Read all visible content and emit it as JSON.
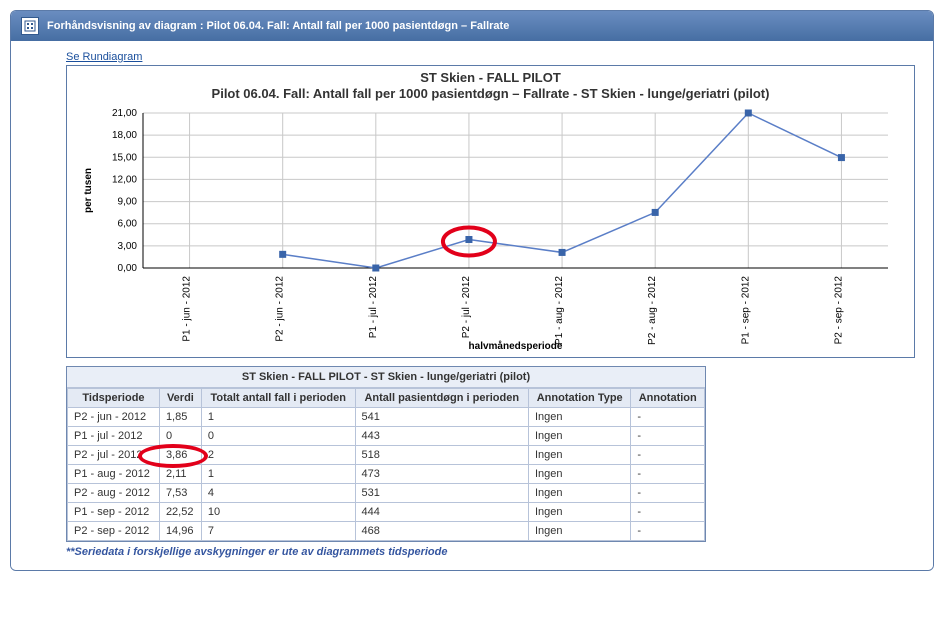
{
  "header": {
    "title": "Forhåndsvisning av diagram : Pilot 06.04. Fall: Antall fall per 1000 pasientdøgn – Fallrate"
  },
  "links": {
    "rundiagram": "Se Rundiagram"
  },
  "chart_data": {
    "type": "line",
    "title": "ST Skien - FALL PILOT",
    "subtitle": "Pilot 06.04. Fall: Antall fall per 1000 pasientdøgn – Fallrate - ST Skien - lunge/geriatri (pilot)",
    "ylabel": "per tusen",
    "xlabel": "halvmånedsperiode",
    "ylim": [
      0,
      21
    ],
    "yticks": [
      0,
      3,
      6,
      9,
      12,
      15,
      18,
      21
    ],
    "ytick_labels": [
      "0,00",
      "3,00",
      "6,00",
      "9,00",
      "12,00",
      "15,00",
      "18,00",
      "21,00"
    ],
    "categories": [
      "P1 - jun - 2012",
      "P2 - jun - 2012",
      "P1 - jul - 2012",
      "P2 - jul - 2012",
      "P1 - aug - 2012",
      "P2 - aug - 2012",
      "P1 - sep - 2012",
      "P2 - sep - 2012"
    ],
    "values": [
      null,
      1.85,
      0,
      3.86,
      2.11,
      7.53,
      22.52,
      14.96
    ],
    "highlight_index": 3
  },
  "table": {
    "caption": "ST Skien - FALL PILOT - ST Skien - lunge/geriatri (pilot)",
    "headers": [
      "Tidsperiode",
      "Verdi",
      "Totalt antall fall i perioden",
      "Antall pasientdøgn i perioden",
      "Annotation Type",
      "Annotation"
    ],
    "rows": [
      [
        "P2 - jun - 2012",
        "1,85",
        "1",
        "541",
        "Ingen",
        "-"
      ],
      [
        "P1 - jul - 2012",
        "0",
        "0",
        "443",
        "Ingen",
        "-"
      ],
      [
        "P2 - jul - 2012",
        "3,86",
        "2",
        "518",
        "Ingen",
        "-"
      ],
      [
        "P1 - aug - 2012",
        "2,11",
        "1",
        "473",
        "Ingen",
        "-"
      ],
      [
        "P2 - aug - 2012",
        "7,53",
        "4",
        "531",
        "Ingen",
        "-"
      ],
      [
        "P1 - sep - 2012",
        "22,52",
        "10",
        "444",
        "Ingen",
        "-"
      ],
      [
        "P2 - sep - 2012",
        "14,96",
        "7",
        "468",
        "Ingen",
        "-"
      ]
    ],
    "highlight_row": 2,
    "highlight_col": 1
  },
  "footnote": "**Seriedata i forskjellige avskygninger er ute av diagrammets tidsperiode"
}
